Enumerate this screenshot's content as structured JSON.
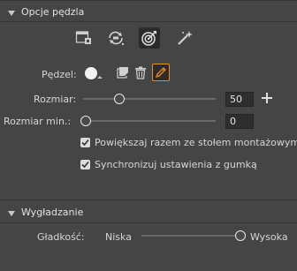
{
  "brush_options": {
    "title": "Opcje pędzla",
    "tool_icons": [
      "brush-preset-icon",
      "airbrush-icon",
      "target-brush-icon",
      "magic-brush-icon"
    ],
    "brush_label": "Pędzel:",
    "size_label": "Rozmiar:",
    "size_value": "50",
    "size_fraction": 0.25,
    "min_size_label": "Rozmiar min.:",
    "min_size_value": "0",
    "min_size_fraction": 0.0,
    "option_scale_with_artboard": "Powiększaj razem ze stołem montażowym",
    "option_sync_with_eraser": "Synchronizuj ustawienia z gumką",
    "option_scale_with_artboard_checked": true,
    "option_sync_with_eraser_checked": true
  },
  "smoothing": {
    "title": "Wygładzanie",
    "smoothness_label": "Gładkość:",
    "low_label": "Niska",
    "high_label": "Wysoka",
    "smoothness_fraction": 1.0
  },
  "colors": {
    "panel_bg": "#454545",
    "selected_icon_bg": "#2b2b2b",
    "pencil_highlight": "#f08a24"
  }
}
